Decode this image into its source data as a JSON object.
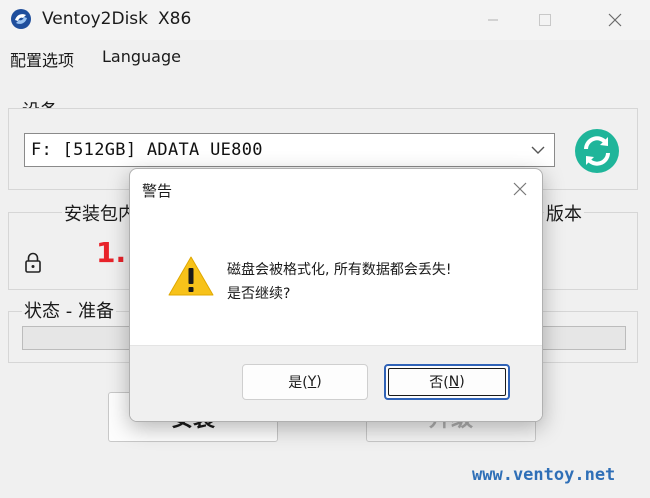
{
  "window": {
    "title": "Ventoy2Disk",
    "arch": "X86"
  },
  "menu": {
    "items": [
      {
        "label": "配置选项"
      },
      {
        "label": "Language"
      }
    ]
  },
  "device": {
    "label": "设备",
    "selected": "F: [512GB] ADATA UE800"
  },
  "info": {
    "package_label_partial": "安装包内",
    "device_version_label_partial": "版本",
    "package_version_partial": "1."
  },
  "status": {
    "label_partial": "状态 - 准备"
  },
  "buttons": {
    "install_label": "安装",
    "upgrade_label": "升级"
  },
  "footer": {
    "link": "www.ventoy.net"
  },
  "dialog": {
    "title": "警告",
    "message_line1": "磁盘会被格式化, 所有数据都会丢失!",
    "message_line2": "是否继续?",
    "yes": {
      "text": "是(",
      "key": "Y",
      "tail": ")"
    },
    "no": {
      "text": "否(",
      "key": "N",
      "tail": ")"
    }
  },
  "colors": {
    "accent": "#2f62b7",
    "refresh_icon": "#1fb59a",
    "version_red": "#e8232a",
    "warning_yellow": "#f7c21a",
    "link_blue": "#2f6fb7"
  }
}
